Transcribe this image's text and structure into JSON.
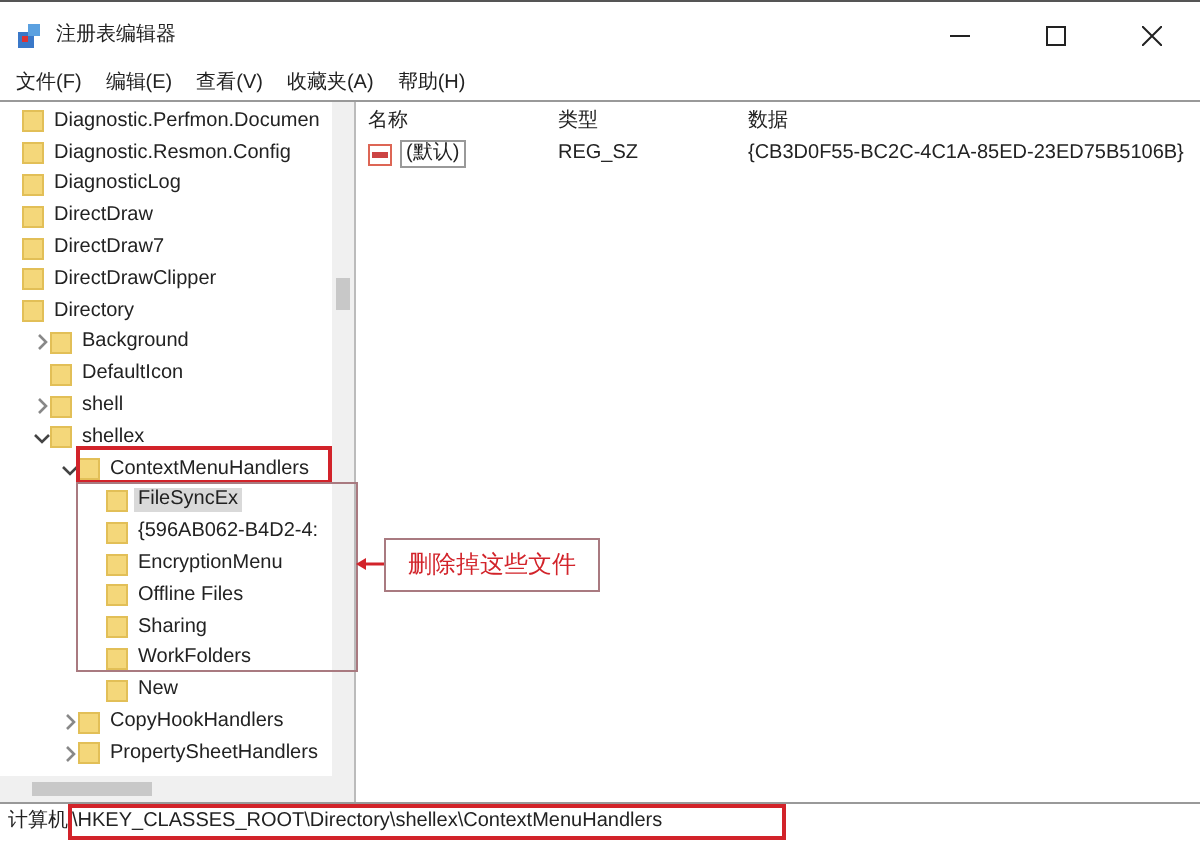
{
  "window": {
    "title": "注册表编辑器"
  },
  "menu": [
    "文件(F)",
    "编辑(E)",
    "查看(V)",
    "收藏夹(A)",
    "帮助(H)"
  ],
  "tree": [
    {
      "label": "Diagnostic.Perfmon.Documen",
      "expandable": false,
      "selected": false
    },
    {
      "label": "Diagnostic.Resmon.Config",
      "expandable": false,
      "selected": false
    },
    {
      "label": "DiagnosticLog",
      "expandable": false,
      "selected": false
    },
    {
      "label": "DirectDraw",
      "expandable": false,
      "selected": false
    },
    {
      "label": "DirectDraw7",
      "expandable": false,
      "selected": false
    },
    {
      "label": "DirectDrawClipper",
      "expandable": false,
      "selected": false
    },
    {
      "label": "Directory",
      "expandable": false,
      "selected": false,
      "children": [
        {
          "label": "Background",
          "expandable": true,
          "expanded": false,
          "selected": false
        },
        {
          "label": "DefaultIcon",
          "expandable": false,
          "selected": false
        },
        {
          "label": "shell",
          "expandable": true,
          "expanded": false,
          "selected": false
        },
        {
          "label": "shellex",
          "expandable": true,
          "expanded": true,
          "selected": false,
          "children": [
            {
              "label": "ContextMenuHandlers",
              "expandable": true,
              "expanded": true,
              "selected": false,
              "children": [
                {
                  "label": "FileSyncEx",
                  "expandable": false,
                  "selected": true
                },
                {
                  "label": "{596AB062-B4D2-4:",
                  "expandable": false,
                  "selected": false
                },
                {
                  "label": "EncryptionMenu",
                  "expandable": false,
                  "selected": false
                },
                {
                  "label": "Offline Files",
                  "expandable": false,
                  "selected": false
                },
                {
                  "label": "Sharing",
                  "expandable": false,
                  "selected": false
                },
                {
                  "label": "WorkFolders",
                  "expandable": false,
                  "selected": false
                },
                {
                  "label": "New",
                  "expandable": false,
                  "selected": false
                }
              ]
            },
            {
              "label": "CopyHookHandlers",
              "expandable": true,
              "expanded": false,
              "selected": false
            },
            {
              "label": "PropertySheetHandlers",
              "expandable": true,
              "expanded": false,
              "selected": false
            }
          ]
        }
      ]
    }
  ],
  "values": {
    "columns": [
      "名称",
      "类型",
      "数据"
    ],
    "rows": [
      {
        "name": "(默认)",
        "type": "REG_SZ",
        "data": "{CB3D0F55-BC2C-4C1A-85ED-23ED75B5106B}"
      }
    ]
  },
  "callout": "删除掉这些文件",
  "status_bar": {
    "root": "计算机",
    "path": "\\HKEY_CLASSES_ROOT\\Directory\\shellex\\ContextMenuHandlers",
    "highlighted": true
  }
}
